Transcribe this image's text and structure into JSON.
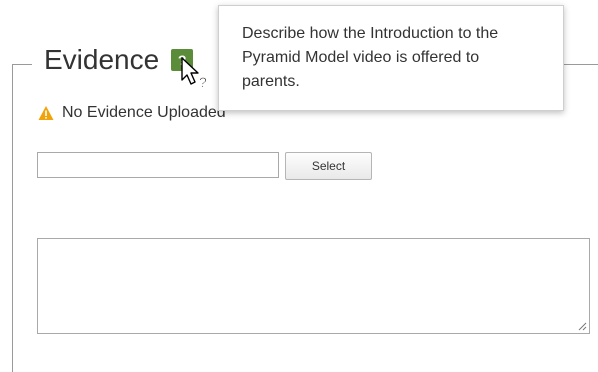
{
  "fieldset": {
    "legend": "Evidence",
    "help_icon": "question-icon"
  },
  "status": {
    "icon": "warning-icon",
    "text": "No Evidence Uploaded",
    "color": "#f0a30a"
  },
  "upload": {
    "file_value": "",
    "select_label": "Select"
  },
  "notes": {
    "value": ""
  },
  "tooltip": {
    "text": "Describe how the Introduction to the Pyramid Model video is offered to parents."
  },
  "cursor": {
    "icon": "help-cursor-icon"
  },
  "colors": {
    "accent": "#5b8c3a",
    "border": "#9a9a9a"
  }
}
